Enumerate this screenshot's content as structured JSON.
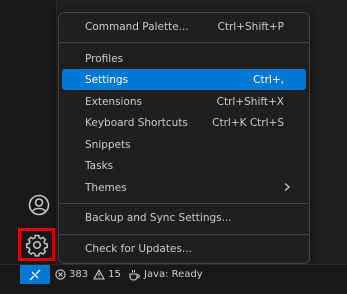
{
  "menu": {
    "items": [
      {
        "label": "Command Palette...",
        "shortcut": "Ctrl+Shift+P"
      },
      {
        "label": "Profiles",
        "shortcut": ""
      },
      {
        "label": "Settings",
        "shortcut": "Ctrl+,"
      },
      {
        "label": "Extensions",
        "shortcut": "Ctrl+Shift+X"
      },
      {
        "label": "Keyboard Shortcuts",
        "shortcut": "Ctrl+K Ctrl+S"
      },
      {
        "label": "Snippets",
        "shortcut": ""
      },
      {
        "label": "Tasks",
        "shortcut": ""
      },
      {
        "label": "Themes",
        "shortcut": ""
      },
      {
        "label": "Backup and Sync Settings...",
        "shortcut": ""
      },
      {
        "label": "Check for Updates...",
        "shortcut": ""
      }
    ],
    "active_item": "Settings"
  },
  "status_bar": {
    "errors": "383",
    "warnings": "15",
    "java_status": "Java: Ready"
  },
  "icons": {
    "account": "account-icon",
    "settings": "gear-icon",
    "remote": "remote-icon",
    "errors": "error-icon",
    "warnings": "warning-icon",
    "java": "coffee-icon",
    "submenu": "chevron-right-icon"
  },
  "colors": {
    "accent": "#0078d4",
    "highlight_border": "#e0000f"
  }
}
